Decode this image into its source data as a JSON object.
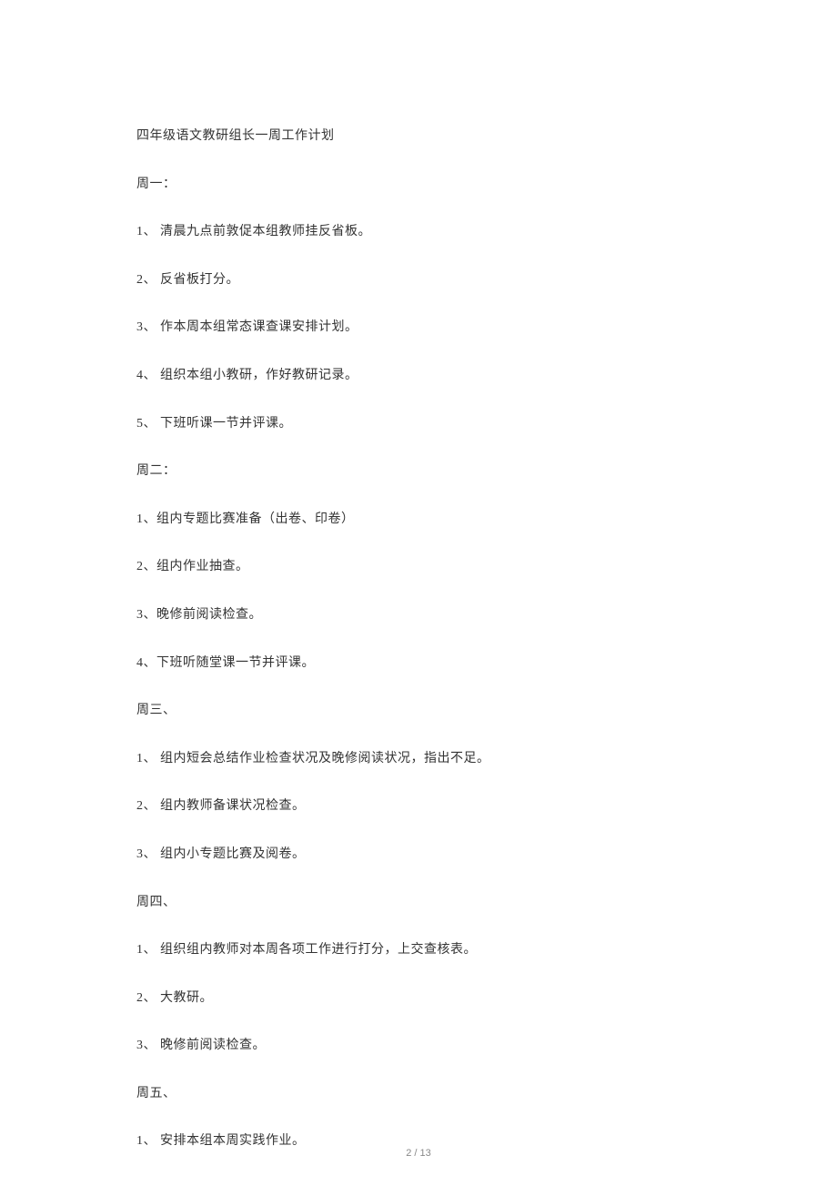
{
  "title": "四年级语文教研组长一周工作计划",
  "sections": [
    {
      "heading": "周一：",
      "items": [
        "1、 清晨九点前敦促本组教师挂反省板。",
        "2、 反省板打分。",
        "3、 作本周本组常态课查课安排计划。",
        "4、 组织本组小教研，作好教研记录。",
        "5、 下班听课一节并评课。"
      ]
    },
    {
      "heading": "周二：",
      "items": [
        "1、组内专题比赛准备（出卷、印卷）",
        "2、组内作业抽查。",
        "3、晚修前阅读检查。",
        "4、下班听随堂课一节并评课。"
      ]
    },
    {
      "heading": "周三、",
      "items": [
        "1、 组内短会总结作业检查状况及晚修阅读状况，指出不足。",
        "2、 组内教师备课状况检查。",
        "3、 组内小专题比赛及阅卷。"
      ]
    },
    {
      "heading": "周四、",
      "items": [
        "1、 组织组内教师对本周各项工作进行打分，上交查核表。",
        "2、  大教研。",
        "3、  晚修前阅读检查。"
      ]
    },
    {
      "heading": "周五、",
      "items": [
        "1、 安排本组本周实践作业。"
      ]
    }
  ],
  "footer": {
    "page_current": "2",
    "page_total": "13",
    "separator": " / "
  }
}
